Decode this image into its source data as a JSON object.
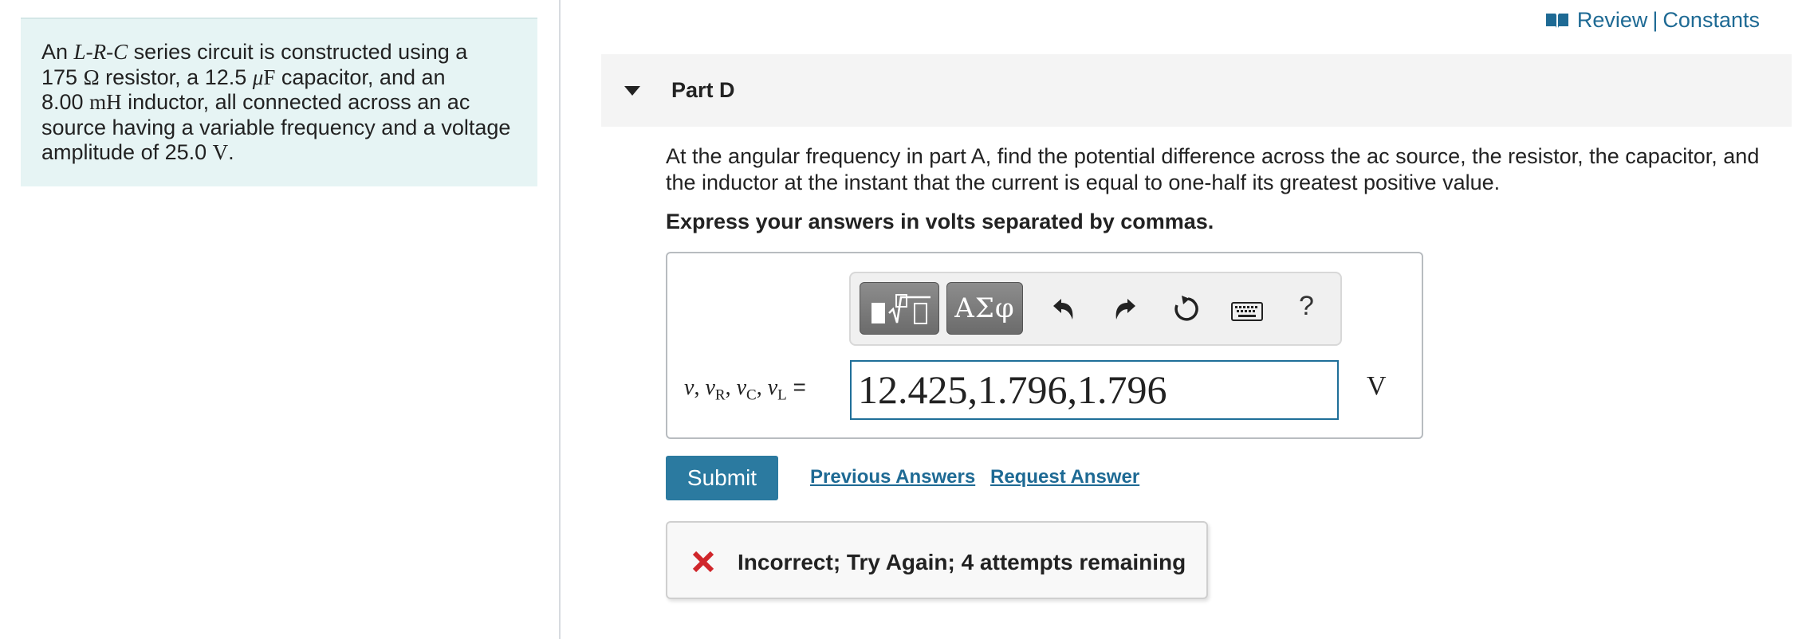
{
  "problem": {
    "line1_pre": "An ",
    "sym_L": "L",
    "dash1": "-",
    "sym_R": "R",
    "dash2": "-",
    "sym_C": "C",
    "line1_post": " series circuit is constructed using a",
    "resistance_value": "175",
    "ohm_symbol": "Ω",
    "resistor_text": " resistor, a 12.5 ",
    "mu_symbol": "μ",
    "farad_unit": "F",
    "capacitor_text": " capacitor, and an",
    "inductance_value": "8.00 ",
    "mh_unit": "mH",
    "inductor_text": " inductor, all connected across an ac",
    "line4": "source having a variable frequency and a voltage",
    "amplitude_text": "amplitude of 25.0 ",
    "volt_unit": "V",
    "period": "."
  },
  "header": {
    "review_label": "Review",
    "separator": "|",
    "constants_label": "Constants"
  },
  "part": {
    "title": "Part D",
    "question": "At the angular frequency in part A, find the potential difference across the ac source, the resistor, the capacitor, and the inductor at the instant that the current is equal to one-half its greatest positive value.",
    "instruction": "Express your answers in volts separated by commas."
  },
  "toolbar": {
    "symbols_label": "ΑΣφ",
    "help_label": "?"
  },
  "equation": {
    "v": "v",
    "sep": ", ",
    "sub_R": "R",
    "sub_C": "C",
    "sub_L": "L",
    "equals": " ="
  },
  "answer": {
    "value": "12.425,1.796,1.796",
    "unit": "V"
  },
  "actions": {
    "submit_label": "Submit",
    "previous_answers_label": "Previous Answers",
    "request_answer_label": "Request Answer"
  },
  "feedback": {
    "text": "Incorrect; Try Again; 4 attempts remaining"
  },
  "colors": {
    "accent": "#2b7aa0",
    "link": "#1e6a94",
    "error": "#d0262b",
    "problem_bg": "#e6f4f4"
  }
}
